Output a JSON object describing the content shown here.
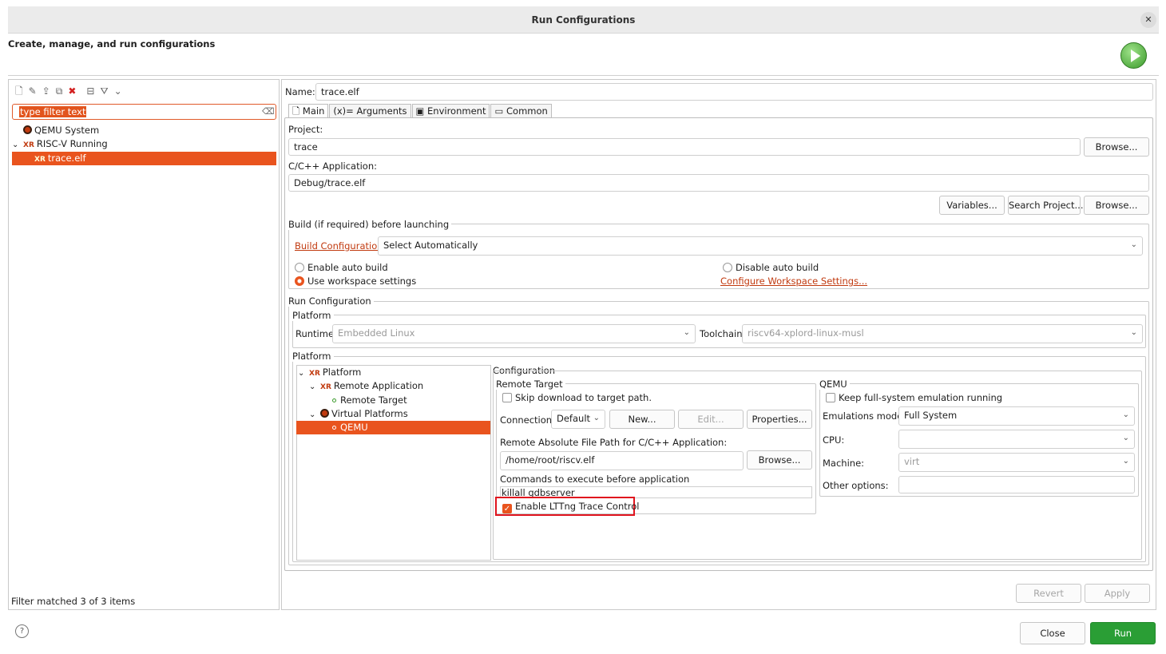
{
  "window": {
    "title": "Run Configurations",
    "header": "Create, manage, and run configurations"
  },
  "left": {
    "filter_placeholder": "type filter text",
    "tree": [
      {
        "label": "QEMU System"
      },
      {
        "label": "RISC-V Running"
      },
      {
        "label": "trace.elf"
      }
    ],
    "status": "Filter matched 3 of 3 items"
  },
  "main": {
    "name_label": "Name:",
    "name_value": "trace.elf",
    "tabs": [
      "Main",
      "Arguments",
      "Environment",
      "Common"
    ],
    "project_label": "Project:",
    "project_value": "trace",
    "browse": "Browse...",
    "app_label": "C/C++ Application:",
    "app_value": "Debug/trace.elf",
    "variables": "Variables...",
    "search_project": "Search Project...",
    "build_group": "Build (if required) before launching",
    "build_config_link": "Build Configuration:",
    "build_config_value": "Select Automatically",
    "enable_auto_build": "Enable auto build",
    "disable_auto_build": "Disable auto build",
    "use_workspace": "Use workspace settings",
    "configure_workspace": "Configure Workspace Settings...",
    "run_config_group": "Run Configuration",
    "platform_group": "Platform",
    "runtime_label": "Runtime",
    "runtime_value": "Embedded Linux",
    "toolchain_label": "Toolchain",
    "toolchain_value": "riscv64-xplord-linux-musl",
    "platform_group2": "Platform",
    "platform_tree": [
      "Platform",
      "Remote Application",
      "Remote Target",
      "Virtual Platforms",
      "QEMU"
    ],
    "configuration_label": "Configuration",
    "remote_target_group": "Remote Target",
    "skip_download": "Skip download to target path.",
    "connection_label": "Connection:",
    "connection_value": "Default",
    "new_btn": "New...",
    "edit_btn": "Edit...",
    "properties_btn": "Properties...",
    "remote_path_label": "Remote Absolute File Path for C/C++ Application:",
    "remote_path_value": "/home/root/riscv.elf",
    "commands_label": "Commands to execute before application",
    "commands_value": "killall gdbserver",
    "lttng_label": "Enable LTTng Trace Control",
    "qemu_group": "QEMU",
    "keep_running": "Keep full-system emulation running",
    "emu_mode_label": "Emulations mode:",
    "emu_mode_value": "Full System",
    "cpu_label": "CPU:",
    "cpu_value": "",
    "machine_label": "Machine:",
    "machine_value": "virt",
    "other_label": "Other options:",
    "other_value": "",
    "revert": "Revert",
    "apply": "Apply"
  },
  "footer": {
    "close": "Close",
    "run": "Run"
  }
}
